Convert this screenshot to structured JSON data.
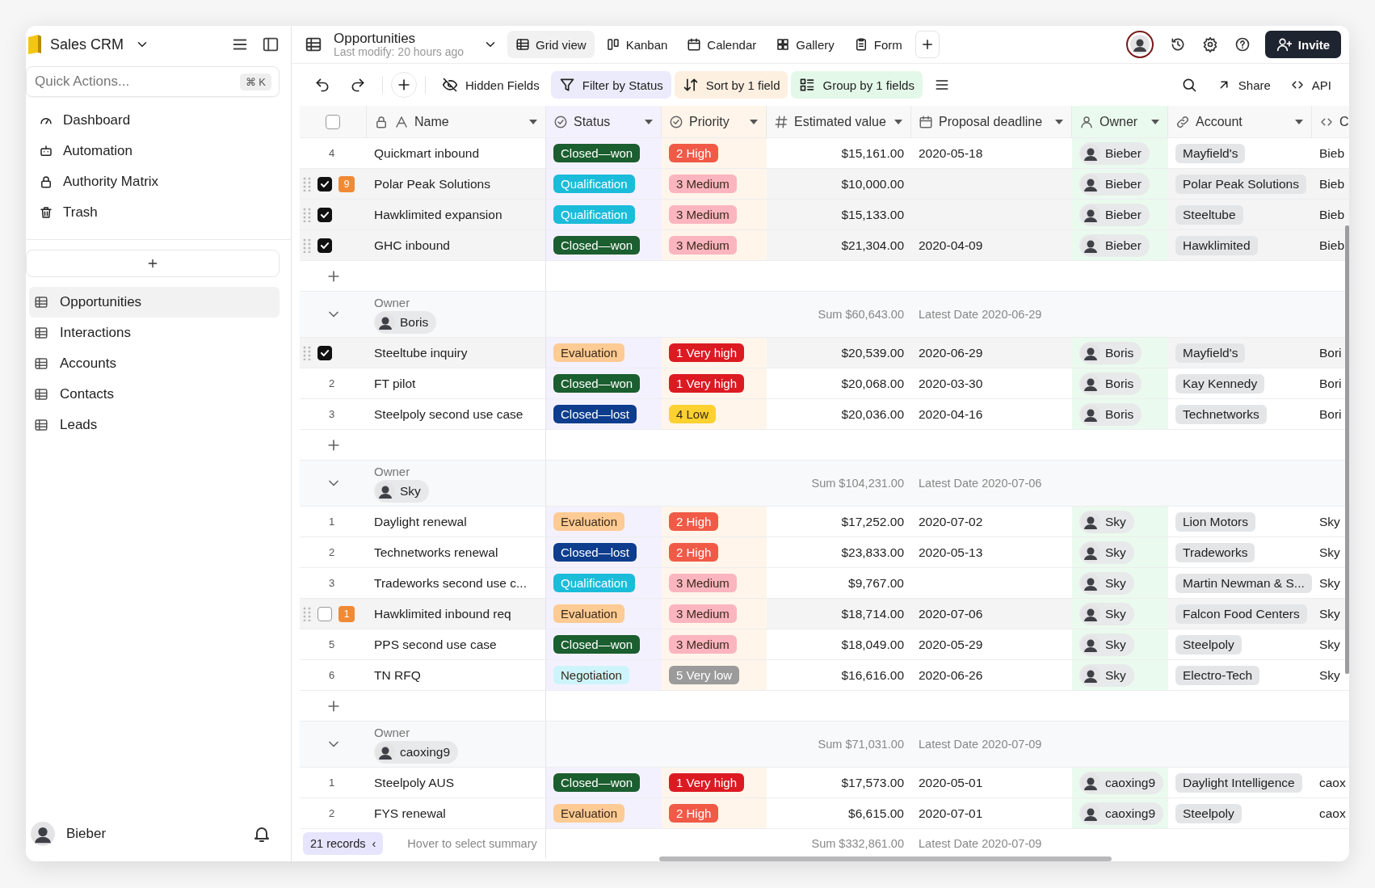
{
  "app": {
    "name": "Sales CRM"
  },
  "sidebar": {
    "search_placeholder": "Quick Actions...",
    "shortcut": "⌘ K",
    "nav": [
      {
        "label": "Dashboard",
        "kind": "dashboard"
      },
      {
        "label": "Automation",
        "kind": "automation"
      },
      {
        "label": "Authority Matrix",
        "kind": "lock"
      },
      {
        "label": "Trash",
        "kind": "trash"
      }
    ],
    "tables": [
      {
        "label": "Opportunities",
        "selected": true
      },
      {
        "label": "Interactions",
        "selected": false
      },
      {
        "label": "Accounts",
        "selected": false
      },
      {
        "label": "Contacts",
        "selected": false
      },
      {
        "label": "Leads",
        "selected": false
      }
    ],
    "user": "Bieber"
  },
  "header": {
    "title": "Opportunities",
    "subtitle": "Last modify: 20 hours ago",
    "views": [
      {
        "label": "Grid view",
        "kind": "grid",
        "selected": true
      },
      {
        "label": "Kanban",
        "kind": "kanban",
        "selected": false
      },
      {
        "label": "Calendar",
        "kind": "calendar",
        "selected": false
      },
      {
        "label": "Gallery",
        "kind": "gallery",
        "selected": false
      },
      {
        "label": "Form",
        "kind": "form",
        "selected": false
      }
    ],
    "invite": "Invite"
  },
  "toolbar": {
    "buttons": [
      {
        "label": "Hidden Fields",
        "kind": "hidden"
      },
      {
        "label": "Filter by Status",
        "kind": "filter"
      },
      {
        "label": "Sort by 1 field",
        "kind": "sort"
      },
      {
        "label": "Group by 1 fields",
        "kind": "group"
      }
    ],
    "share": "Share",
    "api": "API"
  },
  "table": {
    "select_all": {
      "checked": false
    },
    "columns": [
      {
        "label": "Name",
        "kind": "text"
      },
      {
        "label": "Status",
        "kind": "status",
        "color": "#f4f1fe"
      },
      {
        "label": "Priority",
        "kind": "status",
        "color": "#fff5ea"
      },
      {
        "label": "Estimated value",
        "kind": "number"
      },
      {
        "label": "Proposal deadline",
        "kind": "date"
      },
      {
        "label": "Owner",
        "kind": "user",
        "color": "#ebfaee"
      },
      {
        "label": "Account",
        "kind": "link"
      },
      {
        "label": "C",
        "kind": "code"
      }
    ],
    "groups": [
      {
        "add_row": true,
        "rows": [
          {
            "index": "4",
            "name": "Quickmart inbound",
            "status": {
              "label": "Closed—won",
              "color": "#1b5e2f"
            },
            "priority": {
              "label": "2 High",
              "color": "#f05a47"
            },
            "value": "$15,161.00",
            "deadline": "2020-05-18",
            "owner": "Bieber",
            "account": "Mayfield's",
            "column_9": "Bieb"
          },
          {
            "checked": true,
            "comments": "9",
            "name": "Polar Peak Solutions",
            "status": {
              "label": "Qualification",
              "color": "#1bbcd9"
            },
            "priority": {
              "label": "3 Medium",
              "color": "#fbb5bf"
            },
            "value": "$10,000.00",
            "owner": "Bieber",
            "account": "Polar Peak Solutions",
            "column_9": "Bieb"
          },
          {
            "checked": true,
            "name": "Hawklimited expansion",
            "status": {
              "label": "Qualification",
              "color": "#1bbcd9"
            },
            "priority": {
              "label": "3 Medium",
              "color": "#fbb5bf"
            },
            "value": "$15,133.00",
            "owner": "Bieber",
            "account": "Steeltube",
            "column_9": "Bieb"
          },
          {
            "checked": true,
            "name": "GHC inbound",
            "status": {
              "label": "Closed—won",
              "color": "#1b5e2f"
            },
            "priority": {
              "label": "3 Medium",
              "color": "#fbb5bf"
            },
            "value": "$21,304.00",
            "deadline": "2020-04-09",
            "owner": "Bieber",
            "account": "Hawklimited",
            "column_9": "Bieb"
          }
        ]
      },
      {
        "add_row": true,
        "header": {
          "label": "Owner",
          "owner": "Boris",
          "sum": "Sum $60,643.00",
          "latest": "Latest Date 2020-06-29"
        },
        "rows": [
          {
            "checked": true,
            "name": "Steeltube inquiry",
            "status": {
              "label": "Evaluation",
              "color": "#fdcb93"
            },
            "priority": {
              "label": "1 Very high",
              "color": "#dc1a22"
            },
            "value": "$20,539.00",
            "deadline": "2020-06-29",
            "owner": "Boris",
            "account": "Mayfield's",
            "column_9": "Bori"
          },
          {
            "index": "2",
            "name": "FT pilot",
            "status": {
              "label": "Closed—won",
              "color": "#1b5e2f"
            },
            "priority": {
              "label": "1 Very high",
              "color": "#dc1a22"
            },
            "value": "$20,068.00",
            "deadline": "2020-03-30",
            "owner": "Boris",
            "account": "Kay Kennedy",
            "column_9": "Bori"
          },
          {
            "index": "3",
            "name": "Steelpoly second use case",
            "status": {
              "label": "Closed—lost",
              "color": "#0d3d8c"
            },
            "priority": {
              "label": "4 Low",
              "color": "#fdd12f"
            },
            "value": "$20,036.00",
            "deadline": "2020-04-16",
            "owner": "Boris",
            "account": "Technetworks",
            "column_9": "Bori"
          }
        ]
      },
      {
        "add_row": true,
        "header": {
          "label": "Owner",
          "owner": "Sky",
          "sum": "Sum $104,231.00",
          "latest": "Latest Date 2020-07-06"
        },
        "rows": [
          {
            "index": "1",
            "name": "Daylight renewal",
            "status": {
              "label": "Evaluation",
              "color": "#fdcb93"
            },
            "priority": {
              "label": "2 High",
              "color": "#f05a47"
            },
            "value": "$17,252.00",
            "deadline": "2020-07-02",
            "owner": "Sky",
            "account": "Lion Motors",
            "column_9": "Sky"
          },
          {
            "index": "2",
            "name": "Technetworks renewal",
            "status": {
              "label": "Closed—lost",
              "color": "#0d3d8c"
            },
            "priority": {
              "label": "2 High",
              "color": "#f05a47"
            },
            "value": "$23,833.00",
            "deadline": "2020-05-13",
            "owner": "Sky",
            "account": "Tradeworks",
            "column_9": "Sky"
          },
          {
            "index": "3",
            "name": "Tradeworks second use c...",
            "status": {
              "label": "Qualification",
              "color": "#1bbcd9"
            },
            "priority": {
              "label": "3 Medium",
              "color": "#fbb5bf"
            },
            "value": "$9,767.00",
            "owner": "Sky",
            "account": "Martin Newman & S...",
            "column_9": "Sky"
          },
          {
            "checked": false,
            "comments": "1",
            "name": "Hawklimited inbound req",
            "status": {
              "label": "Evaluation",
              "color": "#fdcb93"
            },
            "priority": {
              "label": "3 Medium",
              "color": "#fbb5bf"
            },
            "value": "$18,714.00",
            "deadline": "2020-07-06",
            "owner": "Sky",
            "account": "Falcon Food Centers",
            "column_9": "Sky"
          },
          {
            "index": "5",
            "name": "PPS second use case",
            "status": {
              "label": "Closed—won",
              "color": "#1b5e2f"
            },
            "priority": {
              "label": "3 Medium",
              "color": "#fbb5bf"
            },
            "value": "$18,049.00",
            "deadline": "2020-05-29",
            "owner": "Sky",
            "account": "Steelpoly",
            "column_9": "Sky"
          },
          {
            "index": "6",
            "name": "TN RFQ",
            "status": {
              "label": "Negotiation",
              "color": "#cef4fb"
            },
            "priority": {
              "label": "5 Very low",
              "color": "#9b9b9b"
            },
            "value": "$16,616.00",
            "deadline": "2020-06-26",
            "owner": "Sky",
            "account": "Electro-Tech",
            "column_9": "Sky"
          }
        ]
      },
      {
        "add_row": false,
        "header": {
          "label": "Owner",
          "owner": "caoxing9",
          "sum": "Sum $71,031.00",
          "latest": "Latest Date 2020-07-09"
        },
        "rows": [
          {
            "index": "1",
            "name": "Steelpoly AUS",
            "status": {
              "label": "Closed—won",
              "color": "#1b5e2f"
            },
            "priority": {
              "label": "1 Very high",
              "color": "#dc1a22"
            },
            "value": "$17,573.00",
            "deadline": "2020-05-01",
            "owner": "caoxing9",
            "account": "Daylight Intelligence",
            "column_9": "caox"
          },
          {
            "index": "2",
            "name": "FYS renewal",
            "status": {
              "label": "Evaluation",
              "color": "#fdcb93"
            },
            "priority": {
              "label": "2 High",
              "color": "#f05a47"
            },
            "value": "$6,615.00",
            "deadline": "2020-07-01",
            "owner": "caoxing9",
            "account": "Steelpoly",
            "column_9": "caox"
          }
        ]
      }
    ],
    "footer": {
      "records": "21 records",
      "collapse": "‹",
      "hint": "Hover to select summary",
      "sum": "Sum $332,861.00",
      "latest": "Latest Date 2020-07-09"
    }
  }
}
